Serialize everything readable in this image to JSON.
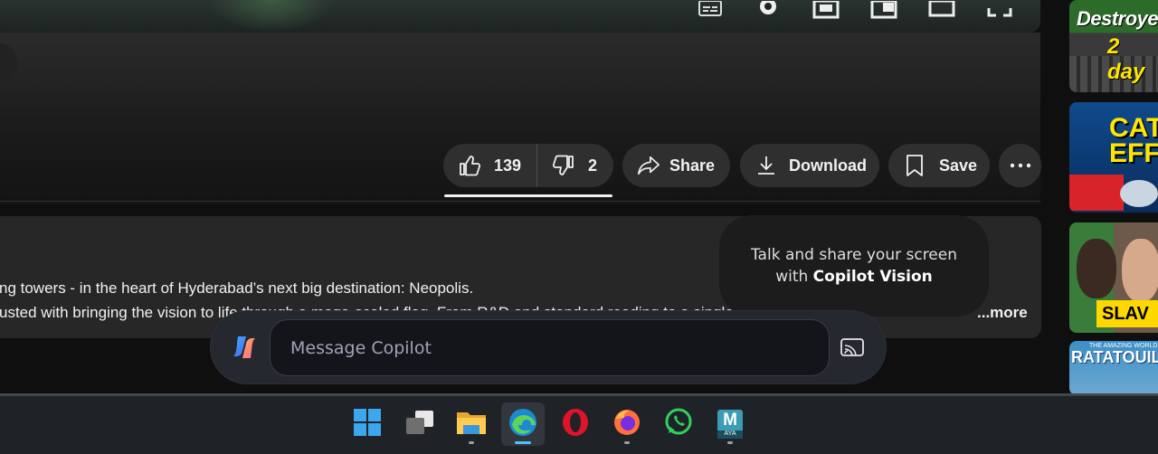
{
  "video": {
    "controls": [
      "subtitles-icon",
      "gear-icon",
      "miniplayer-icon",
      "theater-icon",
      "fullscreen-window-icon",
      "fullscreen-icon"
    ]
  },
  "actions": {
    "like_count": "139",
    "dislike_count": "2",
    "share_label": "Share",
    "download_label": "Download",
    "save_label": "Save"
  },
  "description": {
    "line1": "ng towers - in the heart of Hyderabad’s next big destination: Neopolis.",
    "line2": "usted with bringing the vision to life through a mega-scaled flag. From R&D and standard reading to a single building",
    "more": "...more"
  },
  "sidebar": {
    "thumb1": {
      "line1": "Destroye",
      "line2": "2 day"
    },
    "thumb2": {
      "line1": "CAT",
      "line2": "EFF"
    },
    "thumb3": {
      "label": "SLAV"
    },
    "thumb4": {
      "small": "THE AMAZING WORLD",
      "title": "RATATOUILLE"
    }
  },
  "copilot": {
    "tooltip_line1": "Talk and share your screen",
    "tooltip_prefix": "with ",
    "tooltip_bold": "Copilot Vision",
    "placeholder": "Message Copilot"
  },
  "taskbar": {
    "apps": [
      "start",
      "task-view",
      "file-explorer",
      "edge",
      "opera",
      "firefox",
      "whatsapp",
      "maya"
    ],
    "maya_label": "M",
    "maya_sub": "AYA",
    "accent": "#4cc2ff"
  }
}
